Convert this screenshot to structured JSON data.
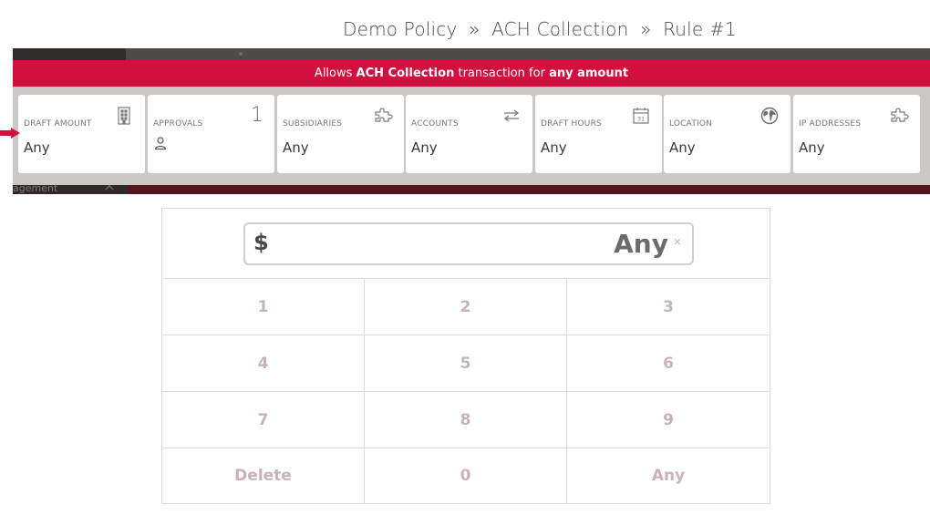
{
  "breadcrumb": {
    "policy": "Demo Policy",
    "separator": "»",
    "transaction": "ACH Collection",
    "rule": "Rule #1"
  },
  "banner": {
    "prefix": "Allows",
    "transaction": "ACH Collection",
    "middle": "transaction for",
    "amount": "any amount"
  },
  "cards": [
    {
      "label": "DRAFT AMOUNT",
      "value": "Any",
      "icon": "building-icon"
    },
    {
      "label": "APPROVALS",
      "value": "",
      "count": "1",
      "icon": "person-icon"
    },
    {
      "label": "SUBSIDIARIES",
      "value": "Any",
      "icon": "puzzle-icon"
    },
    {
      "label": "ACCOUNTS",
      "value": "Any",
      "icon": "transfer-arrows-icon"
    },
    {
      "label": "DRAFT HOURS",
      "value": "Any",
      "icon": "calendar-icon",
      "icon_text": "31"
    },
    {
      "label": "LOCATION",
      "value": "Any",
      "icon": "globe-icon"
    },
    {
      "label": "IP ADDRESSES",
      "value": "Any",
      "icon": "puzzle-icon"
    }
  ],
  "background_nav": {
    "partial_label": "agement"
  },
  "keypad": {
    "currency": "$",
    "display_value": "Any",
    "clear_symbol": "×",
    "keys": [
      [
        "1",
        "2",
        "3"
      ],
      [
        "4",
        "5",
        "6"
      ],
      [
        "7",
        "8",
        "9"
      ],
      [
        "Delete",
        "0",
        "Any"
      ]
    ]
  },
  "colors": {
    "banner": "#d2103f",
    "key_text": "#c9b1bb",
    "arrow": "#d2103f"
  }
}
